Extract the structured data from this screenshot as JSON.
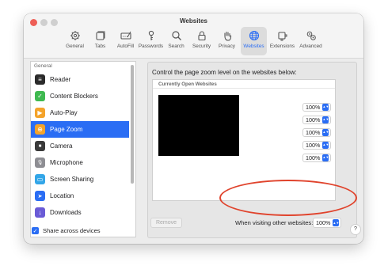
{
  "window": {
    "title": "Websites"
  },
  "toolbar": [
    {
      "label": "General",
      "icon": "gear-icon"
    },
    {
      "label": "Tabs",
      "icon": "tabs-icon"
    },
    {
      "label": "AutoFill",
      "icon": "autofill-icon"
    },
    {
      "label": "Passwords",
      "icon": "key-icon"
    },
    {
      "label": "Search",
      "icon": "search-icon"
    },
    {
      "label": "Security",
      "icon": "lock-icon"
    },
    {
      "label": "Privacy",
      "icon": "hand-icon"
    },
    {
      "label": "Websites",
      "icon": "globe-icon",
      "active": true
    },
    {
      "label": "Extensions",
      "icon": "extensions-icon"
    },
    {
      "label": "Advanced",
      "icon": "advanced-gear-icon"
    }
  ],
  "sidebar": {
    "header": "General",
    "items": [
      {
        "label": "Reader",
        "icon": "reader-icon",
        "color": "#2b2b2b",
        "glyph": "≡"
      },
      {
        "label": "Content Blockers",
        "icon": "content-blocker-icon",
        "color": "#3fb950",
        "glyph": "✓"
      },
      {
        "label": "Auto-Play",
        "icon": "play-icon",
        "color": "#f4a32a",
        "glyph": "▶"
      },
      {
        "label": "Page Zoom",
        "icon": "zoom-icon",
        "color": "#f4a32a",
        "glyph": "⊕",
        "selected": true
      },
      {
        "label": "Camera",
        "icon": "camera-icon",
        "color": "#3a3a3a",
        "glyph": "■"
      },
      {
        "label": "Microphone",
        "icon": "microphone-icon",
        "color": "#8e8e93",
        "glyph": "🎙"
      },
      {
        "label": "Screen Sharing",
        "icon": "screen-sharing-icon",
        "color": "#33a6e8",
        "glyph": "▭"
      },
      {
        "label": "Location",
        "icon": "location-icon",
        "color": "#2a6df4",
        "glyph": "➤"
      },
      {
        "label": "Downloads",
        "icon": "downloads-icon",
        "color": "#6a5bd6",
        "glyph": "↓"
      }
    ]
  },
  "main": {
    "description": "Control the page zoom level on the websites below:",
    "list_header": "Currently Open Websites",
    "site_zooms": [
      "100%",
      "100%",
      "100%",
      "100%",
      "100%"
    ],
    "remove_label": "Remove",
    "other_label": "When visiting other websites:",
    "other_value": "100%"
  },
  "footer": {
    "share_label": "Share across devices",
    "share_checked": true,
    "help": "?"
  },
  "colors": {
    "accent": "#2a6df4",
    "annotation": "#e0432c"
  }
}
